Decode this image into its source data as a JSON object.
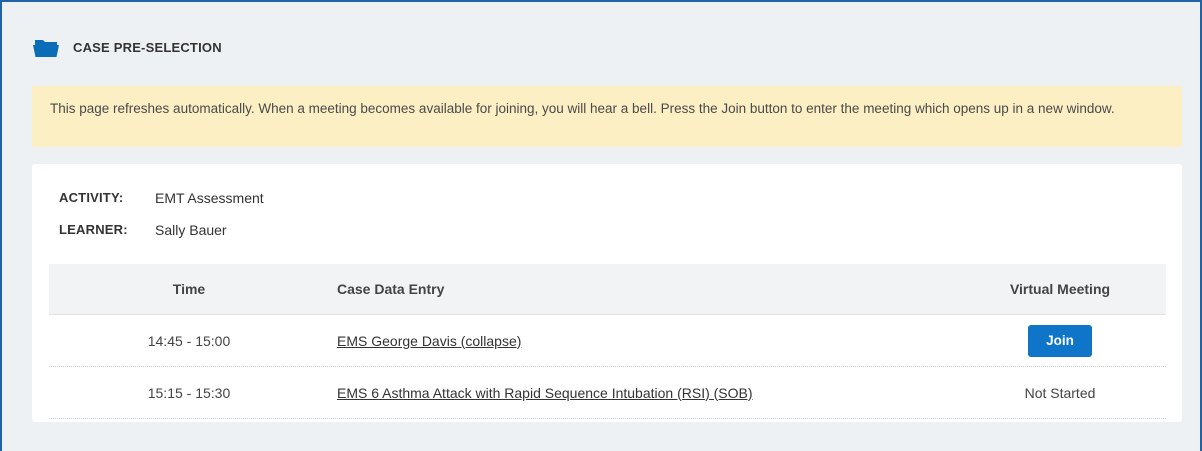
{
  "header": {
    "title": "CASE PRE-SELECTION",
    "icon": "folder-icon",
    "icon_color": "#0b6db8"
  },
  "notice": {
    "text": "This page refreshes automatically. When a meeting becomes available for joining, you will hear a bell. Press the Join button to enter the meeting which opens up in a new window."
  },
  "details": {
    "activity_label": "ACTIVITY:",
    "activity_value": "EMT Assessment",
    "learner_label": "LEARNER:",
    "learner_value": "Sally Bauer"
  },
  "table": {
    "columns": [
      "Time",
      "Case Data Entry",
      "Virtual Meeting"
    ],
    "rows": [
      {
        "time": "14:45 - 15:00",
        "case": "EMS George Davis (collapse)",
        "meeting": "Join",
        "meeting_type": "button"
      },
      {
        "time": "15:15 - 15:30",
        "case": "EMS 6 Asthma Attack with Rapid Sequence Intubation (RSI) (SOB)",
        "meeting": "Not Started",
        "meeting_type": "status"
      }
    ]
  },
  "colors": {
    "frame_border": "#1f63a8",
    "notice_bg": "#fcefc4",
    "button_bg": "#0f75c9"
  }
}
